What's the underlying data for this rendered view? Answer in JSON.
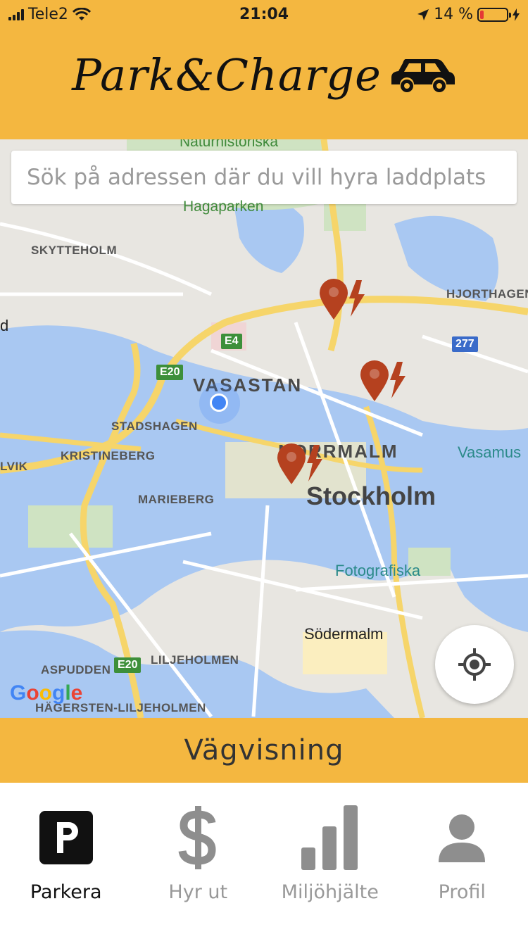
{
  "status_bar": {
    "carrier": "Tele2",
    "time": "21:04",
    "battery_percent": "14 %",
    "battery_level": 0.14
  },
  "header": {
    "title": "Park&Charge",
    "logo_icon": "car-icon"
  },
  "search": {
    "placeholder": "Sök på adressen där du vill hyra laddplats"
  },
  "map": {
    "labels": {
      "naturhistoriska": "Naturhistoriska",
      "hagaparken": "Hagaparken",
      "skytteholm": "SKYTTEHOLM",
      "hjorthagen": "HJORTHAGEN",
      "vasastan": "VASASTAN",
      "stadshagen": "STADSHAGEN",
      "kristineberg": "KRISTINEBERG",
      "lvik": "LVIK",
      "normalm": "NORRMALM",
      "vasamus": "Vasamus",
      "stockholm": "Stockholm",
      "marieberg": "MARIEBERG",
      "fotografiska": "Fotografiska",
      "sodermalm": "Södermalm",
      "aspudden": "ASPUDDEN",
      "liljeholmen": "LILJEHOLMEN",
      "hagersten": "HÄGERSTEN-LILJEHOLMEN",
      "d": "d"
    },
    "shields": {
      "e4": "E4",
      "e20a": "E20",
      "e20b": "E20",
      "r277": "277"
    },
    "google": "Google",
    "markers": [
      "charging-station-marker",
      "charging-station-marker",
      "charging-station-marker"
    ]
  },
  "route_button": {
    "label": "Vägvisning"
  },
  "tabs": [
    {
      "label": "Parkera",
      "icon": "parking-icon",
      "active": true
    },
    {
      "label": "Hyr ut",
      "icon": "dollar-icon",
      "active": false
    },
    {
      "label": "Miljöhjälte",
      "icon": "bar-chart-icon",
      "active": false
    },
    {
      "label": "Profil",
      "icon": "person-icon",
      "active": false
    }
  ],
  "colors": {
    "accent": "#f4b740",
    "marker": "#b5411f",
    "user": "#4285f4"
  }
}
